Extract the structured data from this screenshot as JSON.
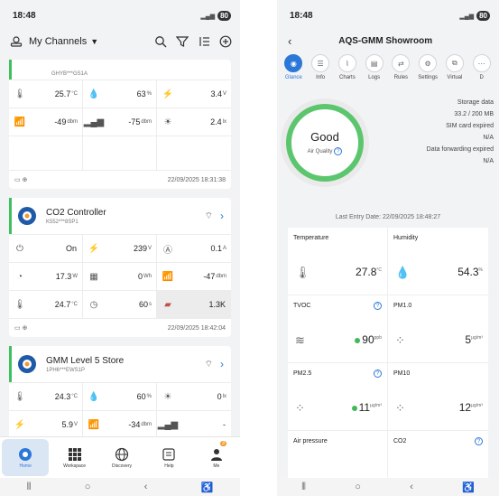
{
  "left": {
    "status": {
      "time": "18:48",
      "battery": "80"
    },
    "topbar": {
      "title": "My Channels"
    },
    "cards": [
      {
        "id": "GHYB***GS1A",
        "rows": [
          [
            {
              "val": "25.7",
              "unit": "°C"
            },
            {
              "val": "63",
              "unit": "%"
            },
            {
              "val": "3.4",
              "unit": "V"
            }
          ],
          [
            {
              "val": "-49",
              "unit": "dbm"
            },
            {
              "val": "-75",
              "unit": "dbm"
            },
            {
              "val": "2.4",
              "unit": "lx"
            }
          ],
          [
            {
              "val": "",
              "unit": ""
            },
            {
              "val": "",
              "unit": ""
            },
            {
              "val": "",
              "unit": ""
            }
          ]
        ],
        "date": "22/09/2025 18:31:38"
      },
      {
        "name": "CO2 Controller",
        "id": "K552***8SP1",
        "rows": [
          [
            {
              "val": "On",
              "unit": ""
            },
            {
              "val": "239",
              "unit": "V"
            },
            {
              "val": "0.1",
              "unit": "A"
            }
          ],
          [
            {
              "val": "17.3",
              "unit": "W"
            },
            {
              "val": "0",
              "unit": "Wh"
            },
            {
              "val": "-47",
              "unit": "dbm"
            }
          ],
          [
            {
              "val": "24.7",
              "unit": "°C"
            },
            {
              "val": "60",
              "unit": "s"
            },
            {
              "val": "1.3K",
              "unit": ""
            }
          ]
        ],
        "date": "22/09/2025 18:42:04"
      },
      {
        "name": "GMM Level 5 Store",
        "id": "1PH6***EWS1P",
        "rows": [
          [
            {
              "val": "24.3",
              "unit": "°C"
            },
            {
              "val": "60",
              "unit": "%"
            },
            {
              "val": "0",
              "unit": "lx"
            }
          ],
          [
            {
              "val": "5.9",
              "unit": "V"
            },
            {
              "val": "-34",
              "unit": "dbm"
            },
            {
              "val": "-",
              "unit": ""
            }
          ]
        ]
      }
    ],
    "nav": [
      {
        "label": "Home"
      },
      {
        "label": "Workspace"
      },
      {
        "label": "Discovery"
      },
      {
        "label": "Help"
      },
      {
        "label": "Me",
        "badge": "3"
      }
    ]
  },
  "right": {
    "status": {
      "time": "18:48",
      "battery": "80"
    },
    "title": "AQS-GMM Showroom",
    "tabs": [
      "Glance",
      "Info",
      "Charts",
      "Logs",
      "Rules",
      "Settings",
      "Virtual",
      "D"
    ],
    "quality": {
      "label": "Good",
      "sub": "Air Quality"
    },
    "info": {
      "storage_label": "Storage data",
      "storage_value": "33.2 / 200 MB",
      "sim_label": "SIM card expired",
      "sim_value": "N/A",
      "fwd_label": "Data forwarding expired",
      "fwd_value": "N/A"
    },
    "last_entry": "Last Entry Date:  22/09/2025 18:48:27",
    "sensors": [
      {
        "title": "Temperature",
        "value": "27.8",
        "unit": "°C"
      },
      {
        "title": "Humidity",
        "value": "54.3",
        "unit": "%"
      },
      {
        "title": "TVOC",
        "value": "90",
        "unit": "ppb"
      },
      {
        "title": "PM1.0",
        "value": "5",
        "unit": "μg/m³"
      },
      {
        "title": "PM2.5",
        "value": "11",
        "unit": "μg/m³"
      },
      {
        "title": "PM10",
        "value": "12",
        "unit": "μg/m³"
      },
      {
        "title": "Air pressure",
        "value": "",
        "unit": ""
      },
      {
        "title": "CO2",
        "value": "",
        "unit": ""
      }
    ]
  }
}
